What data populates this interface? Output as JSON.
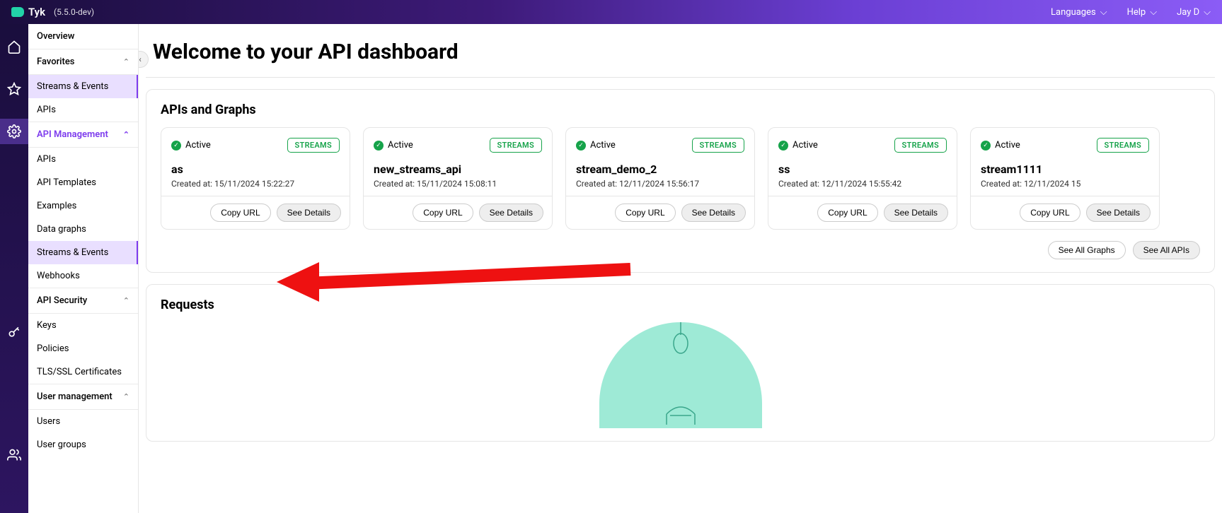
{
  "topbar": {
    "brand": "Tyk",
    "version": "(5.5.0-dev)",
    "languages": "Languages",
    "help": "Help",
    "user": "Jay D"
  },
  "sidebar": {
    "overview": "Overview",
    "favorites": "Favorites",
    "fav_items": [
      "Streams & Events",
      "APIs"
    ],
    "api_management": "API Management",
    "api_mgmt_items": [
      "APIs",
      "API Templates",
      "Examples",
      "Data graphs",
      "Streams & Events",
      "Webhooks"
    ],
    "api_security": "API Security",
    "api_sec_items": [
      "Keys",
      "Policies",
      "TLS/SSL Certificates"
    ],
    "user_management": "User management",
    "user_mgmt_items": [
      "Users",
      "User groups"
    ]
  },
  "page": {
    "title": "Welcome to your API dashboard",
    "apis_and_graphs": "APIs and Graphs",
    "requests": "Requests",
    "see_all_graphs": "See All Graphs",
    "see_all_apis": "See All APIs",
    "copy_url": "Copy URL",
    "see_details": "See Details",
    "status_active": "Active",
    "badge_streams": "STREAMS",
    "created_at_label": "Created at: "
  },
  "cards": [
    {
      "name": "as",
      "created": "15/11/2024 15:22:27"
    },
    {
      "name": "new_streams_api",
      "created": "15/11/2024 15:08:11"
    },
    {
      "name": "stream_demo_2",
      "created": "12/11/2024 15:56:17"
    },
    {
      "name": "ss",
      "created": "12/11/2024 15:55:42"
    },
    {
      "name": "stream1111",
      "created": "12/11/2024 15"
    }
  ]
}
